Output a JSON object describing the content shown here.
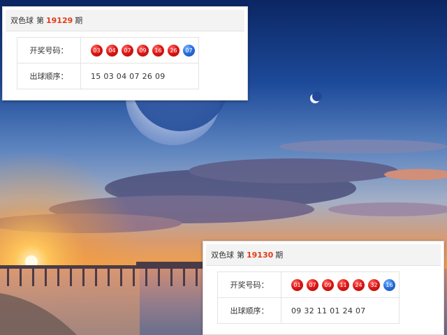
{
  "cards": [
    {
      "lottery_name": "双色球",
      "prefix": "第",
      "issue": "19129",
      "suffix": "期",
      "draw_label": "开奖号码：",
      "red_balls": [
        "03",
        "04",
        "07",
        "09",
        "16",
        "26"
      ],
      "blue_ball": "07",
      "order_label": "出球顺序：",
      "order_value": "15 03 04 07 26 09"
    },
    {
      "lottery_name": "双色球",
      "prefix": "第",
      "issue": "19130",
      "suffix": "期",
      "draw_label": "开奖号码：",
      "red_balls": [
        "01",
        "07",
        "09",
        "11",
        "24",
        "32"
      ],
      "blue_ball": "16",
      "order_label": "出球顺序：",
      "order_value": "09 32 11 01 24 07"
    }
  ],
  "colors": {
    "issue_accent": "#e23c17",
    "red_ball": "#e01818",
    "blue_ball": "#2a71e0"
  }
}
